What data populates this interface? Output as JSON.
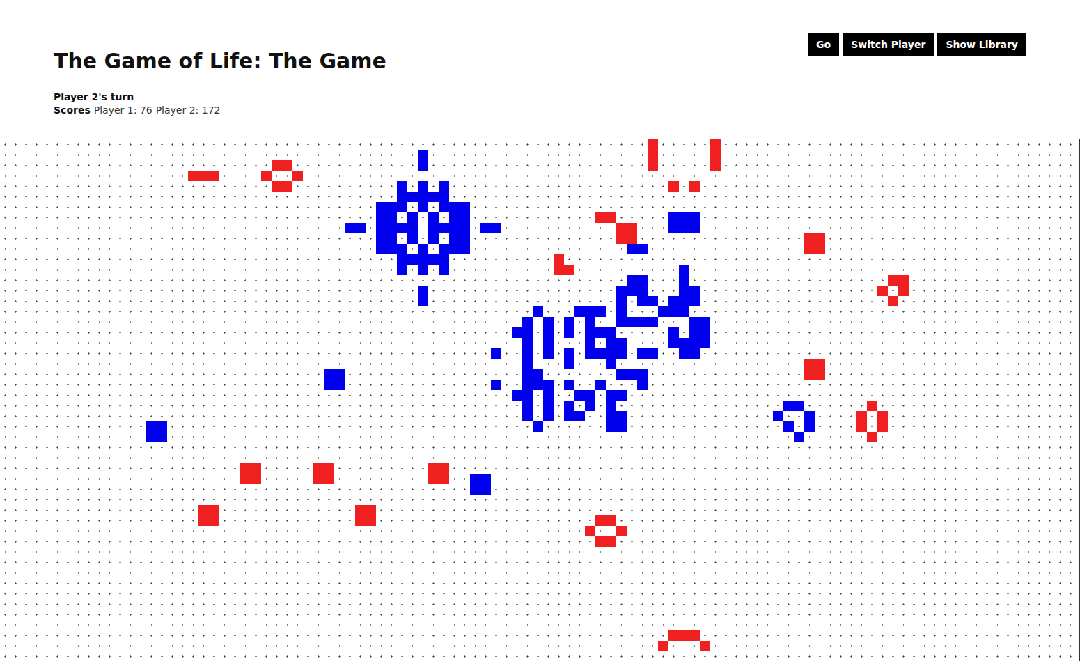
{
  "title": "The Game of Life: The Game",
  "turn": "Player 2's turn",
  "scores": {
    "label": "Scores",
    "entries": [
      "Player 1: 76",
      "Player 2: 172"
    ]
  },
  "buttons": [
    "Go",
    "Switch Player",
    "Show Library"
  ],
  "players": [
    {
      "color": "#f02020",
      "cells": [
        [
          3,
          18
        ],
        [
          3,
          19
        ],
        [
          3,
          20
        ],
        [
          2,
          26
        ],
        [
          2,
          27
        ],
        [
          3,
          25
        ],
        [
          3,
          28
        ],
        [
          4,
          26
        ],
        [
          4,
          27
        ],
        [
          0,
          62
        ],
        [
          1,
          62
        ],
        [
          2,
          62
        ],
        [
          0,
          68
        ],
        [
          1,
          68
        ],
        [
          2,
          68
        ],
        [
          4,
          64
        ],
        [
          4,
          66
        ],
        [
          7,
          57
        ],
        [
          7,
          58
        ],
        [
          8,
          59
        ],
        [
          8,
          60
        ],
        [
          9,
          59
        ],
        [
          9,
          60
        ],
        [
          9,
          77
        ],
        [
          9,
          78
        ],
        [
          10,
          77
        ],
        [
          10,
          78
        ],
        [
          11,
          53
        ],
        [
          12,
          53
        ],
        [
          12,
          54
        ],
        [
          13,
          85
        ],
        [
          13,
          86
        ],
        [
          14,
          84
        ],
        [
          14,
          86
        ],
        [
          15,
          85
        ],
        [
          21,
          77
        ],
        [
          21,
          78
        ],
        [
          22,
          77
        ],
        [
          22,
          78
        ],
        [
          25,
          83
        ],
        [
          26,
          82
        ],
        [
          26,
          84
        ],
        [
          27,
          82
        ],
        [
          27,
          84
        ],
        [
          28,
          83
        ],
        [
          31,
          23
        ],
        [
          31,
          24
        ],
        [
          32,
          23
        ],
        [
          32,
          24
        ],
        [
          31,
          30
        ],
        [
          31,
          31
        ],
        [
          32,
          30
        ],
        [
          32,
          31
        ],
        [
          31,
          41
        ],
        [
          31,
          42
        ],
        [
          32,
          41
        ],
        [
          32,
          42
        ],
        [
          35,
          19
        ],
        [
          35,
          20
        ],
        [
          36,
          19
        ],
        [
          36,
          20
        ],
        [
          35,
          34
        ],
        [
          35,
          35
        ],
        [
          36,
          34
        ],
        [
          36,
          35
        ],
        [
          36,
          57
        ],
        [
          36,
          58
        ],
        [
          37,
          56
        ],
        [
          37,
          59
        ],
        [
          38,
          57
        ],
        [
          38,
          58
        ],
        [
          47,
          64
        ],
        [
          47,
          65
        ],
        [
          47,
          66
        ],
        [
          48,
          63
        ],
        [
          48,
          67
        ]
      ]
    },
    {
      "color": "#0000ee",
      "cells": [
        [
          1,
          40
        ],
        [
          2,
          40
        ],
        [
          14,
          40
        ],
        [
          15,
          40
        ],
        [
          8,
          33
        ],
        [
          8,
          34
        ],
        [
          8,
          46
        ],
        [
          8,
          47
        ],
        [
          4,
          38
        ],
        [
          4,
          40
        ],
        [
          4,
          42
        ],
        [
          5,
          38
        ],
        [
          5,
          39
        ],
        [
          5,
          40
        ],
        [
          5,
          41
        ],
        [
          5,
          42
        ],
        [
          6,
          36
        ],
        [
          6,
          37
        ],
        [
          6,
          38
        ],
        [
          6,
          40
        ],
        [
          6,
          42
        ],
        [
          6,
          43
        ],
        [
          6,
          44
        ],
        [
          7,
          36
        ],
        [
          7,
          37
        ],
        [
          7,
          39
        ],
        [
          7,
          41
        ],
        [
          7,
          43
        ],
        [
          7,
          44
        ],
        [
          8,
          36
        ],
        [
          8,
          37
        ],
        [
          8,
          38
        ],
        [
          8,
          39
        ],
        [
          8,
          41
        ],
        [
          8,
          42
        ],
        [
          8,
          43
        ],
        [
          8,
          44
        ],
        [
          9,
          36
        ],
        [
          9,
          37
        ],
        [
          9,
          39
        ],
        [
          9,
          41
        ],
        [
          9,
          43
        ],
        [
          9,
          44
        ],
        [
          10,
          36
        ],
        [
          10,
          37
        ],
        [
          10,
          38
        ],
        [
          10,
          40
        ],
        [
          10,
          42
        ],
        [
          10,
          43
        ],
        [
          10,
          44
        ],
        [
          11,
          38
        ],
        [
          11,
          39
        ],
        [
          11,
          40
        ],
        [
          11,
          41
        ],
        [
          11,
          42
        ],
        [
          12,
          38
        ],
        [
          12,
          40
        ],
        [
          12,
          42
        ],
        [
          10,
          60
        ],
        [
          10,
          61
        ],
        [
          7,
          64
        ],
        [
          7,
          65
        ],
        [
          7,
          66
        ],
        [
          8,
          64
        ],
        [
          8,
          65
        ],
        [
          8,
          66
        ],
        [
          22,
          31
        ],
        [
          22,
          32
        ],
        [
          23,
          31
        ],
        [
          23,
          32
        ],
        [
          27,
          14
        ],
        [
          27,
          15
        ],
        [
          28,
          14
        ],
        [
          28,
          15
        ],
        [
          32,
          45
        ],
        [
          32,
          46
        ],
        [
          33,
          45
        ],
        [
          33,
          46
        ],
        [
          25,
          75
        ],
        [
          25,
          76
        ],
        [
          26,
          74
        ],
        [
          26,
          77
        ],
        [
          27,
          75
        ],
        [
          27,
          77
        ],
        [
          28,
          76
        ],
        [
          12,
          65
        ],
        [
          13,
          60
        ],
        [
          13,
          61
        ],
        [
          13,
          65
        ],
        [
          14,
          59
        ],
        [
          14,
          60
        ],
        [
          14,
          61
        ],
        [
          14,
          65
        ],
        [
          14,
          66
        ],
        [
          15,
          59
        ],
        [
          15,
          61
        ],
        [
          15,
          62
        ],
        [
          15,
          64
        ],
        [
          15,
          65
        ],
        [
          15,
          66
        ],
        [
          16,
          51
        ],
        [
          16,
          55
        ],
        [
          16,
          56
        ],
        [
          16,
          57
        ],
        [
          16,
          59
        ],
        [
          16,
          63
        ],
        [
          16,
          64
        ],
        [
          16,
          65
        ],
        [
          17,
          50
        ],
        [
          17,
          52
        ],
        [
          17,
          54
        ],
        [
          17,
          56
        ],
        [
          17,
          59
        ],
        [
          17,
          60
        ],
        [
          17,
          61
        ],
        [
          17,
          62
        ],
        [
          17,
          66
        ],
        [
          17,
          67
        ],
        [
          18,
          49
        ],
        [
          18,
          50
        ],
        [
          18,
          52
        ],
        [
          18,
          54
        ],
        [
          18,
          56
        ],
        [
          18,
          57
        ],
        [
          18,
          58
        ],
        [
          18,
          64
        ],
        [
          18,
          66
        ],
        [
          18,
          67
        ],
        [
          19,
          50
        ],
        [
          19,
          52
        ],
        [
          19,
          56
        ],
        [
          19,
          58
        ],
        [
          19,
          59
        ],
        [
          19,
          64
        ],
        [
          19,
          65
        ],
        [
          19,
          66
        ],
        [
          19,
          67
        ],
        [
          20,
          47
        ],
        [
          20,
          50
        ],
        [
          20,
          52
        ],
        [
          20,
          54
        ],
        [
          20,
          56
        ],
        [
          20,
          57
        ],
        [
          20,
          58
        ],
        [
          20,
          59
        ],
        [
          20,
          61
        ],
        [
          20,
          62
        ],
        [
          20,
          65
        ],
        [
          20,
          66
        ],
        [
          21,
          50
        ],
        [
          21,
          54
        ],
        [
          21,
          58
        ],
        [
          22,
          50
        ],
        [
          22,
          51
        ],
        [
          22,
          59
        ],
        [
          22,
          60
        ],
        [
          22,
          61
        ],
        [
          23,
          47
        ],
        [
          23,
          50
        ],
        [
          23,
          51
        ],
        [
          23,
          52
        ],
        [
          23,
          54
        ],
        [
          23,
          57
        ],
        [
          23,
          61
        ],
        [
          24,
          49
        ],
        [
          24,
          50
        ],
        [
          24,
          52
        ],
        [
          24,
          55
        ],
        [
          24,
          56
        ],
        [
          24,
          58
        ],
        [
          24,
          59
        ],
        [
          25,
          50
        ],
        [
          25,
          52
        ],
        [
          25,
          54
        ],
        [
          25,
          56
        ],
        [
          25,
          58
        ],
        [
          26,
          50
        ],
        [
          26,
          52
        ],
        [
          26,
          54
        ],
        [
          26,
          55
        ],
        [
          26,
          58
        ],
        [
          26,
          59
        ],
        [
          27,
          51
        ],
        [
          27,
          58
        ],
        [
          27,
          59
        ]
      ]
    }
  ]
}
